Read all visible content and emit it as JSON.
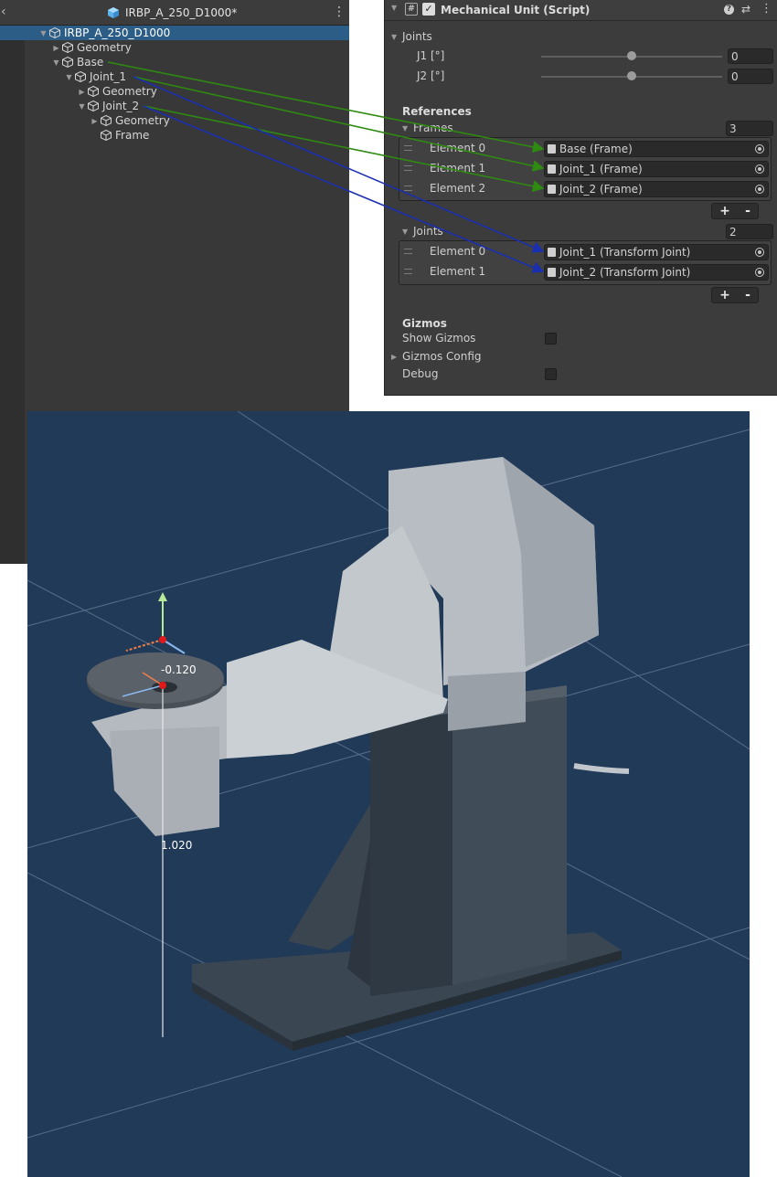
{
  "hierarchy": {
    "back_glyph": "‹",
    "title": "IRBP_A_250_D1000*",
    "menu_glyph": "⋮",
    "items": [
      {
        "label": "IRBP_A_250_D1000",
        "expander": "▼",
        "selected": true
      },
      {
        "label": "Geometry",
        "expander": "▶"
      },
      {
        "label": "Base",
        "expander": "▼"
      },
      {
        "label": "Joint_1",
        "expander": "▼"
      },
      {
        "label": "Geometry",
        "expander": "▶"
      },
      {
        "label": "Joint_2",
        "expander": "▼"
      },
      {
        "label": "Geometry",
        "expander": "▶"
      },
      {
        "label": "Frame",
        "expander": ""
      }
    ]
  },
  "inspector": {
    "component_title": "Mechanical Unit (Script)",
    "enabled": true,
    "header_icons": [
      "help-icon",
      "presets-icon",
      "more-icon"
    ],
    "joints_section": "Joints",
    "sliders": [
      {
        "label": "J1 [°]",
        "value": "0",
        "level": 0.5
      },
      {
        "label": "J2 [°]",
        "value": "0",
        "level": 0.5
      }
    ],
    "references_label": "References",
    "frames": {
      "label": "Frames",
      "count": "3",
      "elements": [
        {
          "label": "Element 0",
          "value": "Base (Frame)"
        },
        {
          "label": "Element 1",
          "value": "Joint_1 (Frame)"
        },
        {
          "label": "Element 2",
          "value": "Joint_2 (Frame)"
        }
      ]
    },
    "joints_list": {
      "label": "Joints",
      "count": "2",
      "elements": [
        {
          "label": "Element 0",
          "value": "Joint_1 (Transform Joint)"
        },
        {
          "label": "Element 1",
          "value": "Joint_2 (Transform Joint)"
        }
      ]
    },
    "plus": "+",
    "minus": "-",
    "gizmos_label": "Gizmos",
    "show_gizmos_label": "Show Gizmos",
    "show_gizmos": false,
    "gizmos_config_label": "Gizmos Config",
    "debug_label": "Debug",
    "debug": false
  },
  "annotations": {
    "frame_arrow_color": "#2e8a10",
    "joint_arrow_color": "#1a2fb0"
  },
  "scene": {
    "background": "#213a58",
    "labels": [
      "-0.120",
      "1.020"
    ]
  }
}
